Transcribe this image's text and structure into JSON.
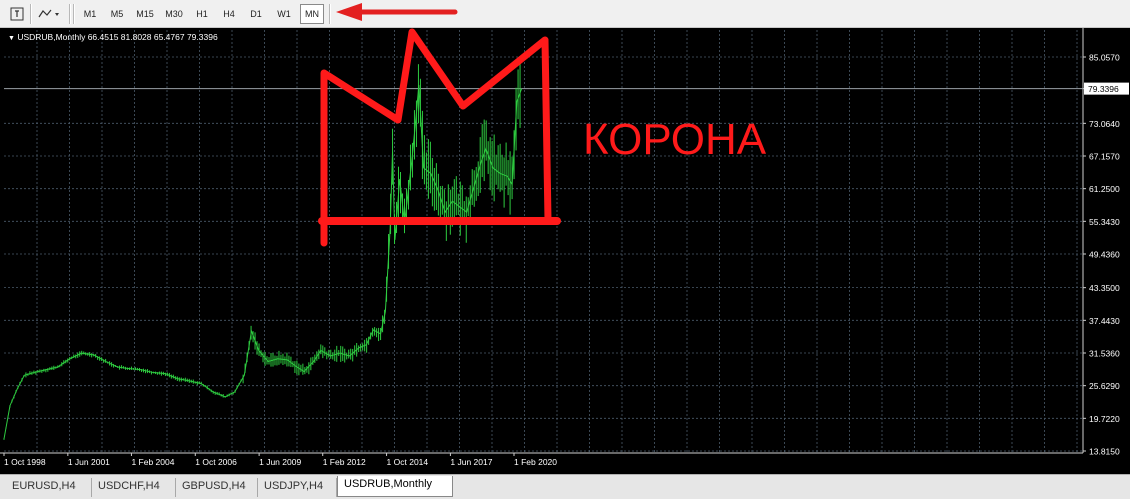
{
  "toolbar": {
    "icons": [
      "cursor-icon",
      "line-tools-icon"
    ],
    "timeframes": [
      {
        "label": "M1",
        "active": false
      },
      {
        "label": "M5",
        "active": false
      },
      {
        "label": "M15",
        "active": false
      },
      {
        "label": "M30",
        "active": false
      },
      {
        "label": "H1",
        "active": false
      },
      {
        "label": "H4",
        "active": false
      },
      {
        "label": "D1",
        "active": false
      },
      {
        "label": "W1",
        "active": false
      },
      {
        "label": "MN",
        "active": true
      }
    ]
  },
  "chart": {
    "header": "USDRUB,Monthly  66.4515 81.8028 65.4767 79.3396",
    "current_price": "79.3396",
    "annotation_text": "КОРОНА",
    "colors": {
      "background": "#000000",
      "bars": "#2ecc40",
      "grid": "#4a5a6a",
      "annotation": "#ff1a1a",
      "price_line": "#9aa0a6"
    }
  },
  "chart_data": {
    "type": "line",
    "title": "USDRUB,Monthly",
    "y_ticks": [
      85.057,
      79.3396,
      73.064,
      67.157,
      61.25,
      55.343,
      49.436,
      43.35,
      37.443,
      31.536,
      25.629,
      19.722,
      13.815
    ],
    "y_tick_labels": [
      "85.0570",
      "79.3396",
      "73.0640",
      "67.1570",
      "61.2500",
      "55.3430",
      "49.4360",
      "43.3500",
      "37.4430",
      "31.5360",
      "25.6290",
      "19.7220",
      "13.8150"
    ],
    "x_tick_labels": [
      "1 Oct 1998",
      "1 Jun 2001",
      "1 Feb 2004",
      "1 Oct 2006",
      "1 Jun 2009",
      "1 Feb 2012",
      "1 Oct 2014",
      "1 Jun 2017",
      "1 Feb 2020"
    ],
    "x_tick_years": [
      1998.75,
      2001.42,
      2004.08,
      2006.75,
      2009.42,
      2012.08,
      2014.75,
      2017.42,
      2020.08
    ],
    "ylim": [
      13.815,
      89.0
    ],
    "xlim": [
      1998.75,
      2021.3
    ],
    "grid": true,
    "series": [
      {
        "x": [
          1998.75,
          1999.0,
          1999.3,
          1999.6,
          2000.0,
          2000.5,
          2001.0,
          2001.5,
          2002.0,
          2002.5,
          2003.0,
          2003.5,
          2004.0,
          2004.5,
          2005.0,
          2005.5,
          2006.0,
          2006.5,
          2007.0,
          2007.5,
          2008.0,
          2008.4,
          2008.8,
          2009.1,
          2009.4,
          2009.8,
          2010.2,
          2010.6,
          2011.0,
          2011.3,
          2011.7,
          2012.0,
          2012.4,
          2012.8,
          2013.2,
          2013.6,
          2013.9,
          2014.2,
          2014.5,
          2014.7,
          2014.9,
          2015.0,
          2015.1,
          2015.3,
          2015.5,
          2015.8,
          2016.0,
          2016.1,
          2016.3,
          2016.6,
          2016.9,
          2017.2,
          2017.5,
          2017.8,
          2018.1,
          2018.4,
          2018.7,
          2018.9,
          2019.2,
          2019.5,
          2019.8,
          2020.0,
          2020.2,
          2020.4
        ],
        "y": [
          16.0,
          22.0,
          25.0,
          27.5,
          28.0,
          28.5,
          29.0,
          30.5,
          31.5,
          31.2,
          30.0,
          29.0,
          28.7,
          28.5,
          28.0,
          27.8,
          26.9,
          26.5,
          26.0,
          24.5,
          23.6,
          24.5,
          27.5,
          35.5,
          32.0,
          30.0,
          30.5,
          30.3,
          29.0,
          28.2,
          30.0,
          32.0,
          31.0,
          31.5,
          31.0,
          32.5,
          33.0,
          35.7,
          35.0,
          39.0,
          54.0,
          68.0,
          52.0,
          63.0,
          55.0,
          66.0,
          75.0,
          80.0,
          65.0,
          64.0,
          61.0,
          57.0,
          59.0,
          58.0,
          57.0,
          61.5,
          66.0,
          68.5,
          65.0,
          64.0,
          63.5,
          62.0,
          77.0,
          79.34
        ]
      }
    ]
  },
  "tabs": [
    {
      "label": "EURUSD,H4",
      "active": false
    },
    {
      "label": "USDCHF,H4",
      "active": false
    },
    {
      "label": "GBPUSD,H4",
      "active": false
    },
    {
      "label": "USDJPY,H4",
      "active": false
    },
    {
      "label": "USDRUB,Monthly",
      "active": true
    }
  ]
}
